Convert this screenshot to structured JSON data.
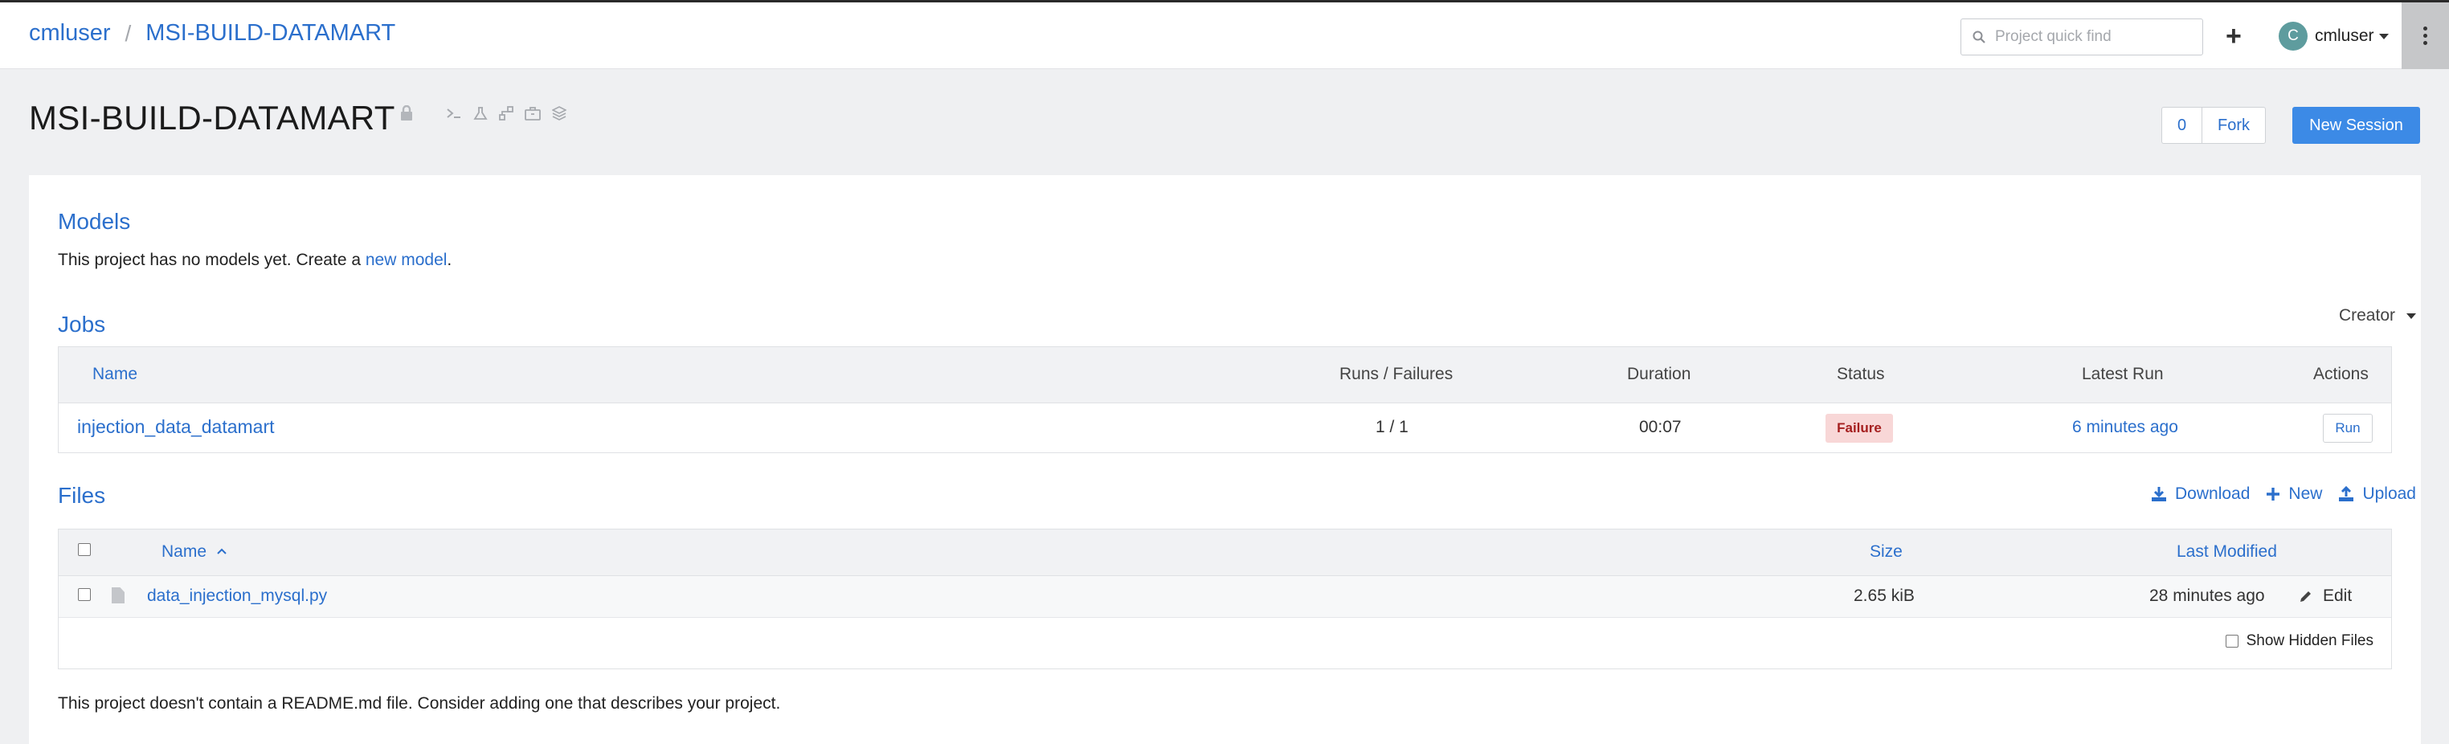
{
  "breadcrumb": {
    "user": "cmluser",
    "separator": "/",
    "project": "MSI-BUILD-DATAMART"
  },
  "search": {
    "placeholder": "Project quick find"
  },
  "topbar": {
    "add_icon": "+",
    "user_initial": "C",
    "user_name": "cmluser"
  },
  "project": {
    "title": "MSI-BUILD-DATAMART",
    "icons": [
      "lock-icon",
      "terminal-icon",
      "experiment-icon",
      "workflow-icon",
      "briefcase-icon",
      "layers-icon"
    ],
    "fork_count": "0",
    "fork_label": "Fork",
    "new_session_label": "New Session"
  },
  "models": {
    "title": "Models",
    "text_before": "This project has no models yet. Create a ",
    "link": "new model",
    "text_after": "."
  },
  "jobs": {
    "title": "Jobs",
    "sort_label": "Creator",
    "columns": [
      "Name",
      "Runs / Failures",
      "Duration",
      "Status",
      "Latest Run",
      "Actions"
    ],
    "rows": [
      {
        "name": "injection_data_datamart",
        "runs_failures": "1 / 1",
        "duration": "00:07",
        "status": "Failure",
        "latest_run": "6 minutes ago",
        "action": "Run"
      }
    ]
  },
  "files": {
    "title": "Files",
    "actions": {
      "download": "Download",
      "new": "New",
      "upload": "Upload"
    },
    "columns": {
      "name": "Name",
      "sort_indicator": "^",
      "size": "Size",
      "last_modified": "Last Modified"
    },
    "rows": [
      {
        "name": "data_injection_mysql.py",
        "size": "2.65 kiB",
        "last_modified": "28 minutes ago",
        "edit": "Edit"
      }
    ],
    "show_hidden_label": "Show Hidden Files"
  },
  "readme_notice": "This project doesn't contain a README.md file. Consider adding one that describes your project.",
  "colors": {
    "accent": "#2b6fcc",
    "primary_button": "#3c8ae6",
    "failure_bg": "#f8d7d7",
    "failure_text": "#a51f1f"
  }
}
